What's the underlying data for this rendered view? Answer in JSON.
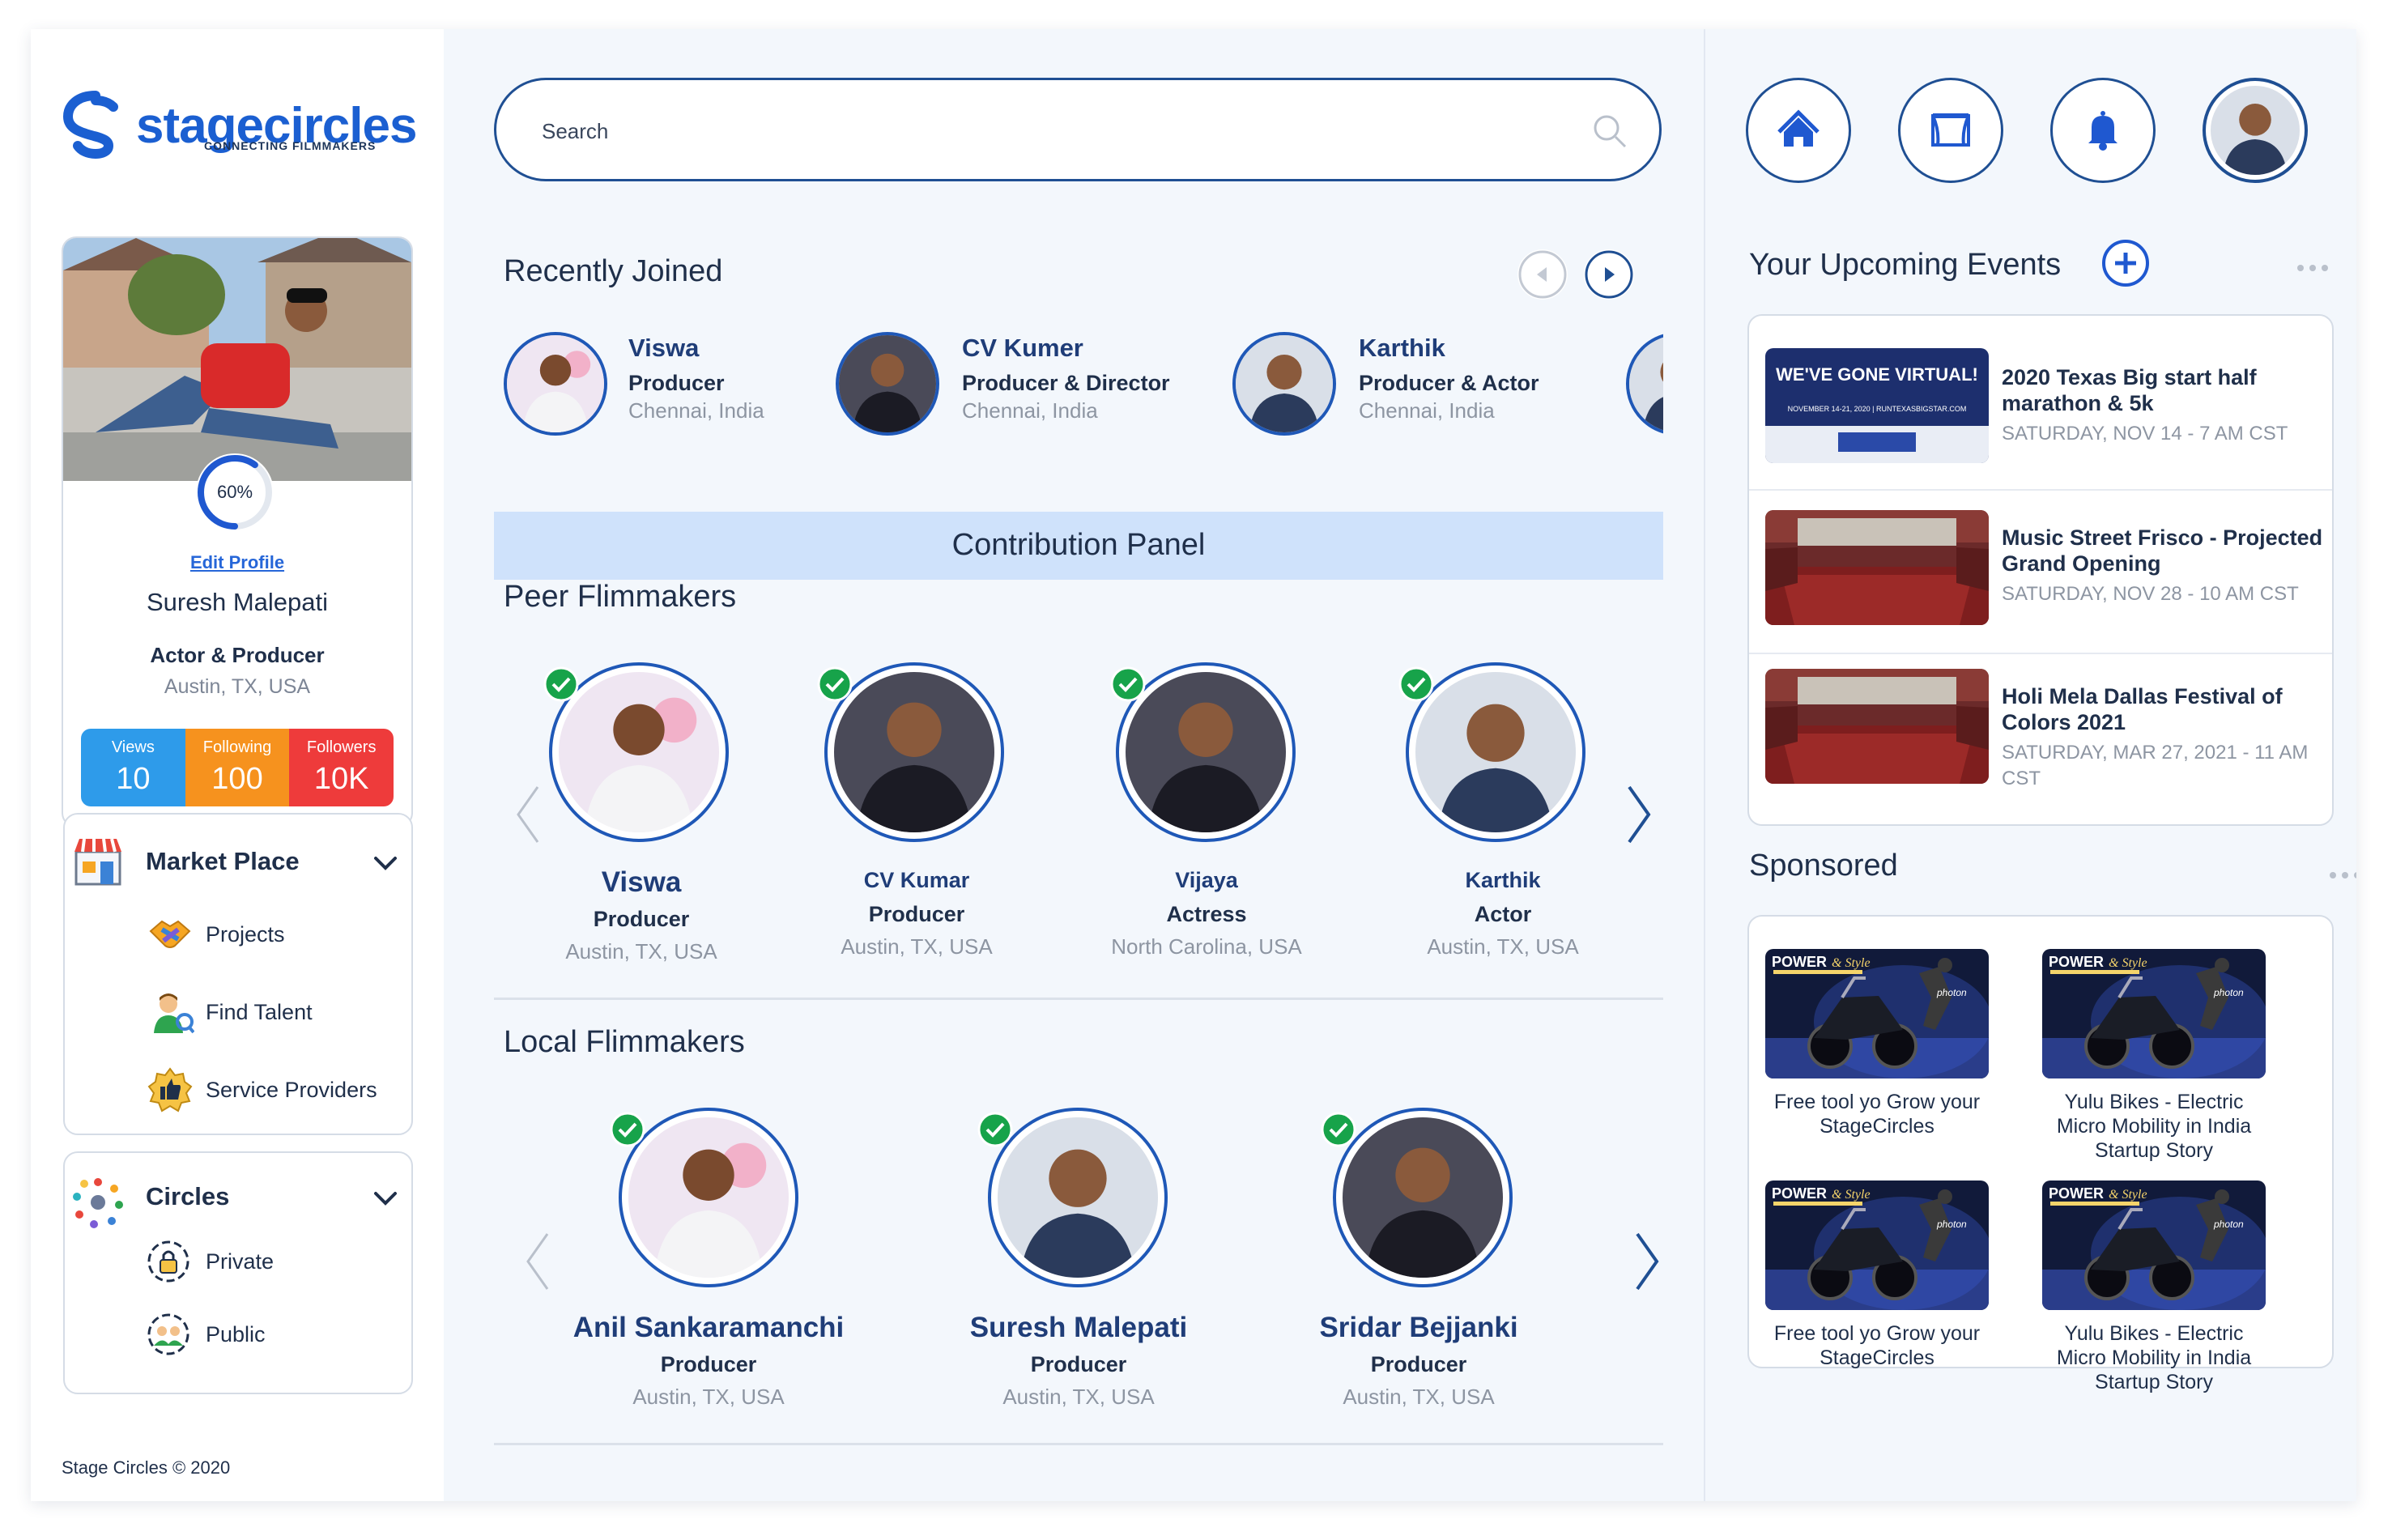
{
  "brand": {
    "name": "stagecircles",
    "tagline": "CONNECTING FILMMAKERS"
  },
  "profile": {
    "completion": "60%",
    "completion_value": 0.6,
    "edit_label": "Edit Profile",
    "name": "Suresh Malepati",
    "role": "Actor & Producer",
    "location": "Austin, TX, USA",
    "stats": [
      {
        "label": "Views",
        "value": "10",
        "color": "#2e9bea"
      },
      {
        "label": "Following",
        "value": "100",
        "color": "#f6921e"
      },
      {
        "label": "Followers",
        "value": "10K",
        "color": "#ee3b3b"
      }
    ]
  },
  "marketplace": {
    "title": "Market Place",
    "items": [
      {
        "label": "Projects",
        "icon": "handshake-icon"
      },
      {
        "label": "Find Talent",
        "icon": "talent-icon"
      },
      {
        "label": "Service Providers",
        "icon": "thumbs-up-icon"
      }
    ]
  },
  "circles": {
    "title": "Circles",
    "items": [
      {
        "label": "Private",
        "icon": "lock-icon"
      },
      {
        "label": "Public",
        "icon": "people-icon"
      }
    ]
  },
  "footer": "Stage Circles © 2020",
  "search": {
    "placeholder": "Search"
  },
  "recently_joined": {
    "title": "Recently Joined",
    "people": [
      {
        "name": "Viswa",
        "role": "Producer",
        "location": "Chennai, India"
      },
      {
        "name": "CV Kumer",
        "role": "Producer & Director",
        "location": "Chennai, India"
      },
      {
        "name": "Karthik",
        "role": "Producer & Actor",
        "location": "Chennai, India"
      }
    ]
  },
  "contribution_panel": "Contribution Panel",
  "peer": {
    "title": "Peer Flimmakers",
    "people": [
      {
        "name": "Viswa",
        "role": "Producer",
        "location": "Austin, TX, USA"
      },
      {
        "name": "CV Kumar",
        "role": "Producer",
        "location": "Austin, TX, USA"
      },
      {
        "name": "Vijaya",
        "role": "Actress",
        "location": "North Carolina, USA"
      },
      {
        "name": "Karthik",
        "role": "Actor",
        "location": "Austin, TX, USA"
      }
    ]
  },
  "local": {
    "title": "Local Flimmakers",
    "people": [
      {
        "name": "Anil Sankaramanchi",
        "role": "Producer",
        "location": "Austin, TX, USA"
      },
      {
        "name": "Suresh Malepati",
        "role": "Producer",
        "location": "Austin, TX, USA"
      },
      {
        "name": "Sridar Bejjanki",
        "role": "Producer",
        "location": "Austin, TX, USA"
      }
    ]
  },
  "topnav": [
    "home-icon",
    "theater-icon",
    "bell-icon",
    "user-avatar"
  ],
  "events": {
    "title": "Your Upcoming Events",
    "items": [
      {
        "title": "2020 Texas Big start half marathon & 5k",
        "date": "SATURDAY, NOV 14 - 7 AM CST",
        "banner": "WE'VE GONE VIRTUAL!",
        "banner_sub": "NOVEMBER 14-21, 2020 | RUNTEXASBIGSTAR.COM"
      },
      {
        "title": "Music Street Frisco - Projected Grand Opening",
        "date": "SATURDAY, NOV 28 - 10 AM CST"
      },
      {
        "title": "Holi Mela Dallas Festival of Colors 2021",
        "date": "SATURDAY, MAR 27, 2021 - 11 AM CST"
      }
    ]
  },
  "sponsored": {
    "title": "Sponsored",
    "items": [
      {
        "title": "Free tool yo Grow your StageCircles"
      },
      {
        "title": "Yulu Bikes - Electric Micro Mobility in India Startup Story"
      },
      {
        "title": "Free tool yo Grow your StageCircles"
      },
      {
        "title": "Yulu Bikes - Electric Micro Mobility in India Startup Story"
      }
    ]
  }
}
